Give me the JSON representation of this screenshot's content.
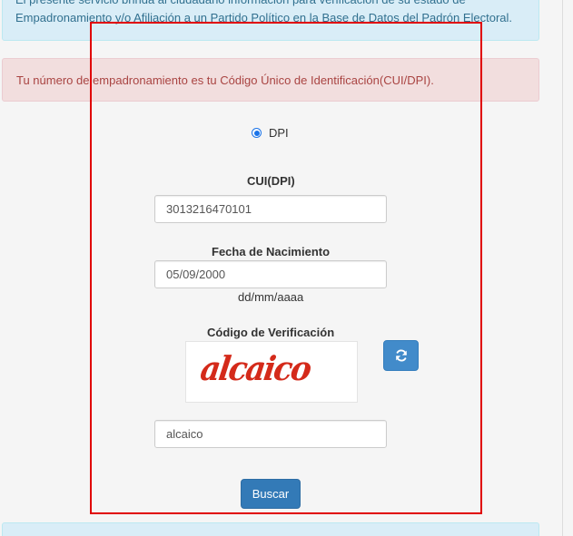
{
  "info_top": {
    "line1": "El presente servicio brinda al ciudadano información para verificación de su estado de",
    "line2": "Empadronamiento y/o Afiliación a un Partido Político en la Base de Datos del Padrón Electoral."
  },
  "alert": {
    "text": "Tu número de empadronamiento es tu Código Único de Identificación(CUI/DPI)."
  },
  "form": {
    "radio": {
      "label": "DPI",
      "checked": true
    },
    "cui": {
      "label": "CUI(DPI)",
      "value": "3013216470101"
    },
    "birth": {
      "label": "Fecha de Nacimiento",
      "value": "05/09/2000",
      "hint": "dd/mm/aaaa"
    },
    "verification": {
      "label": "Código de Verificación",
      "captcha_text": "alcaico",
      "value": "alcaico",
      "refresh_icon": "refresh-icon"
    },
    "submit_label": "Buscar"
  },
  "colors": {
    "info_bg": "#d9edf7",
    "info_text": "#31708f",
    "danger_bg": "#f2dede",
    "danger_text": "#a94442",
    "primary": "#337ab7",
    "highlight": "#e00000",
    "captcha": "#d42a1a"
  }
}
